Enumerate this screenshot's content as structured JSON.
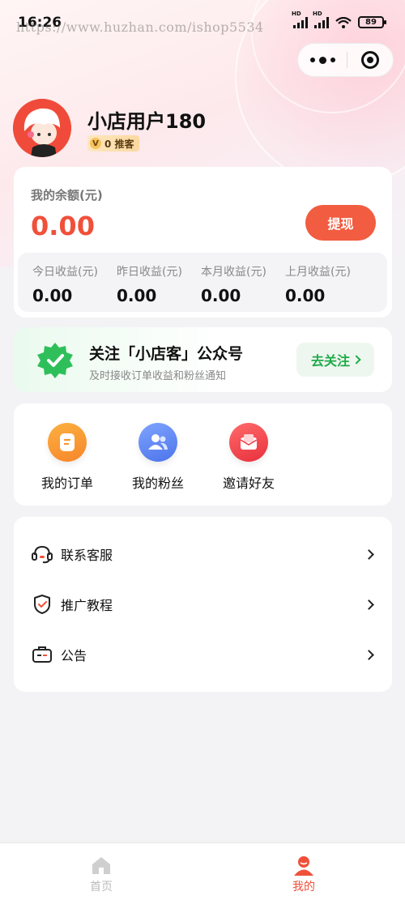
{
  "status_bar": {
    "time": "16:26",
    "battery": "89",
    "network_1": "HD",
    "network_2": "HD"
  },
  "watermark": "https://www.huzhan.com/ishop5534",
  "user": {
    "name": "小店用户180",
    "badge_prefix": "V",
    "badge_text": "0 推客"
  },
  "balance": {
    "label": "我的余额(元)",
    "value": "0.00",
    "withdraw_label": "提现",
    "earnings": [
      {
        "label": "今日收益(元)",
        "value": "0.00"
      },
      {
        "label": "昨日收益(元)",
        "value": "0.00"
      },
      {
        "label": "本月收益(元)",
        "value": "0.00"
      },
      {
        "label": "上月收益(元)",
        "value": "0.00"
      }
    ]
  },
  "follow": {
    "title": "关注「小店客」公众号",
    "subtitle": "及时接收订单收益和粉丝通知",
    "button_label": "去关注",
    "icon": "verified-badge-icon"
  },
  "shortcuts": [
    {
      "label": "我的订单",
      "icon": "order-icon",
      "color": "#f7962b"
    },
    {
      "label": "我的粉丝",
      "icon": "fans-icon",
      "color": "#5b86f4"
    },
    {
      "label": "邀请好友",
      "icon": "invite-icon",
      "color": "#ef3b45"
    }
  ],
  "menu": [
    {
      "label": "联系客服",
      "icon": "customer-service-icon"
    },
    {
      "label": "推广教程",
      "icon": "shield-check-icon"
    },
    {
      "label": "公告",
      "icon": "announcement-icon"
    }
  ],
  "tabbar": [
    {
      "label": "首页",
      "icon": "home-icon",
      "active": false
    },
    {
      "label": "我的",
      "icon": "profile-icon",
      "active": true
    }
  ],
  "colors": {
    "accent": "#f0503a",
    "green": "#1faa48"
  }
}
